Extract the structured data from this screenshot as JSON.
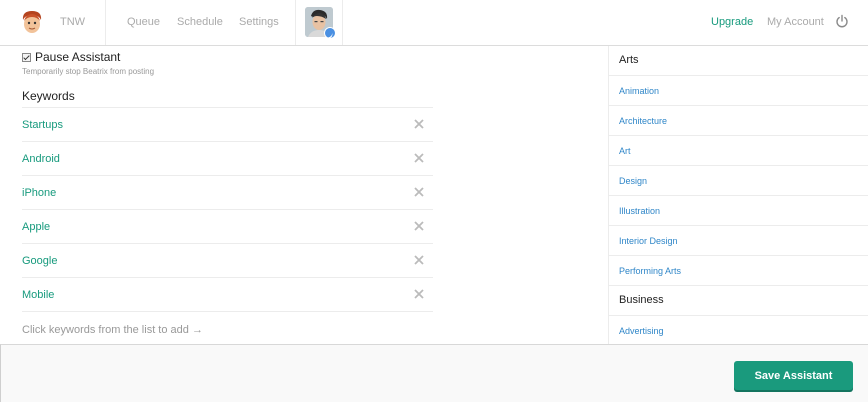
{
  "header": {
    "brand": "TNW",
    "nav": [
      "Queue",
      "Schedule",
      "Settings"
    ],
    "upgrade": "Upgrade",
    "my_account": "My Account",
    "icons": {
      "logo": "cartoon-face-icon",
      "profile": "profile-photo",
      "badge": "twitter-bird-icon",
      "power": "power-icon"
    }
  },
  "pause": {
    "checked": true,
    "label": "Pause Assistant",
    "subtitle": "Temporarily stop Beatrix from posting"
  },
  "keywords": {
    "title": "Keywords",
    "items": [
      "Startups",
      "Android",
      "iPhone",
      "Apple",
      "Google",
      "Mobile"
    ],
    "hint": "Click keywords from the list to add →"
  },
  "sidebar": {
    "groups": [
      {
        "name": "Arts",
        "items": [
          "Animation",
          "Architecture",
          "Art",
          "Design",
          "Illustration",
          "Interior Design",
          "Performing Arts"
        ]
      },
      {
        "name": "Business",
        "items": [
          "Advertising"
        ]
      }
    ]
  },
  "footer": {
    "save_label": "Save Assistant"
  },
  "colors": {
    "accent": "#179a7d",
    "link": "#2f86c8",
    "muted": "#aaaaaa"
  }
}
